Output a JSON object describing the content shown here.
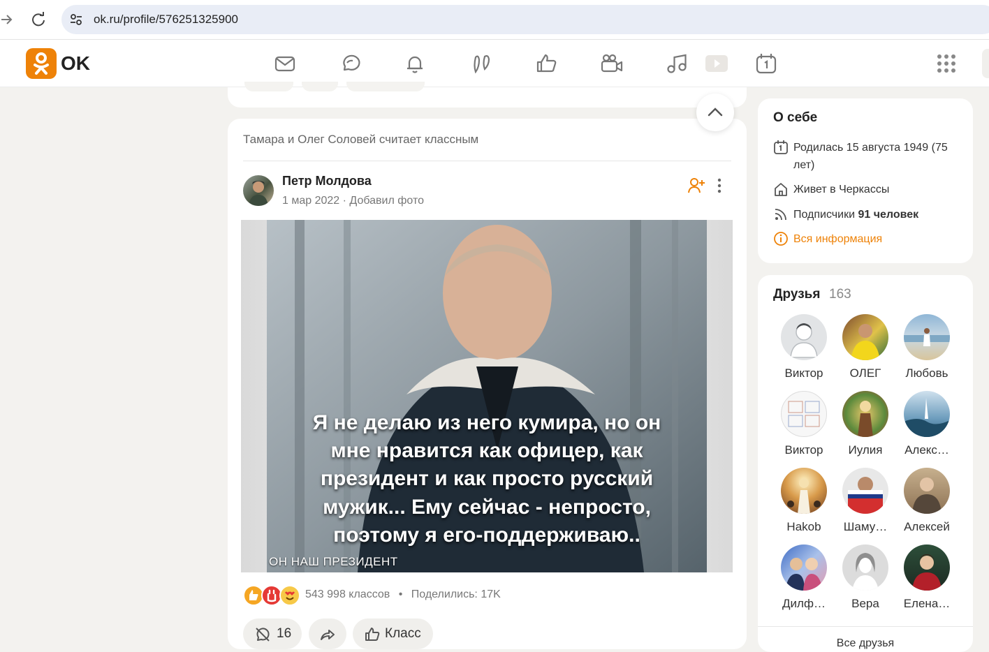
{
  "browser": {
    "url": "ok.ru/profile/576251325900"
  },
  "header": {
    "logo_text": "OK",
    "nav_icons": [
      "mail-icon",
      "discussions-icon",
      "notifications-icon",
      "guests-icon",
      "likes-icon",
      "video-icon",
      "music-icon",
      "video-play-icon",
      "events-icon"
    ],
    "brand_color": "#ee8208"
  },
  "feed": {
    "liked_by": "Тамара и Олег Соловей считает классным",
    "author": {
      "name": "Петр Молдова",
      "date": "1 мар 2022",
      "action": "Добавил фото"
    },
    "photo": {
      "caption_lines": [
        "Я не делаю из него кумира, но он",
        "мне нравится как офицер, как",
        "президент и как просто русский",
        "мужик...  Ему сейчас - непросто,",
        "поэтому я его-поддерживаю.."
      ],
      "footer": "ОН НАШ ПРЕЗИДЕНТ"
    },
    "stats": {
      "classes": "543 998 классов",
      "separator": "•",
      "shares": "Поделились: 17K"
    },
    "actions": {
      "comments_count": "16",
      "class_label": "Класс"
    }
  },
  "about": {
    "title": "О себе",
    "born": "Родилась 15 августа 1949 (75 лет)",
    "lives": "Живет в Черкассы",
    "subscribers_label": "Подписчики",
    "subscribers_value": "91 человек",
    "all_info": "Вся информация"
  },
  "friends": {
    "title": "Друзья",
    "count": "163",
    "items": [
      {
        "name": "Виктор"
      },
      {
        "name": "ОЛЕГ"
      },
      {
        "name": "Любовь"
      },
      {
        "name": "Виктор"
      },
      {
        "name": "Иулия"
      },
      {
        "name": "Алекс…"
      },
      {
        "name": "Hakob"
      },
      {
        "name": "Шаму…"
      },
      {
        "name": "Алексей"
      },
      {
        "name": "Дилф…"
      },
      {
        "name": "Вера"
      },
      {
        "name": "Елена…"
      }
    ],
    "all_label": "Все друзья"
  }
}
